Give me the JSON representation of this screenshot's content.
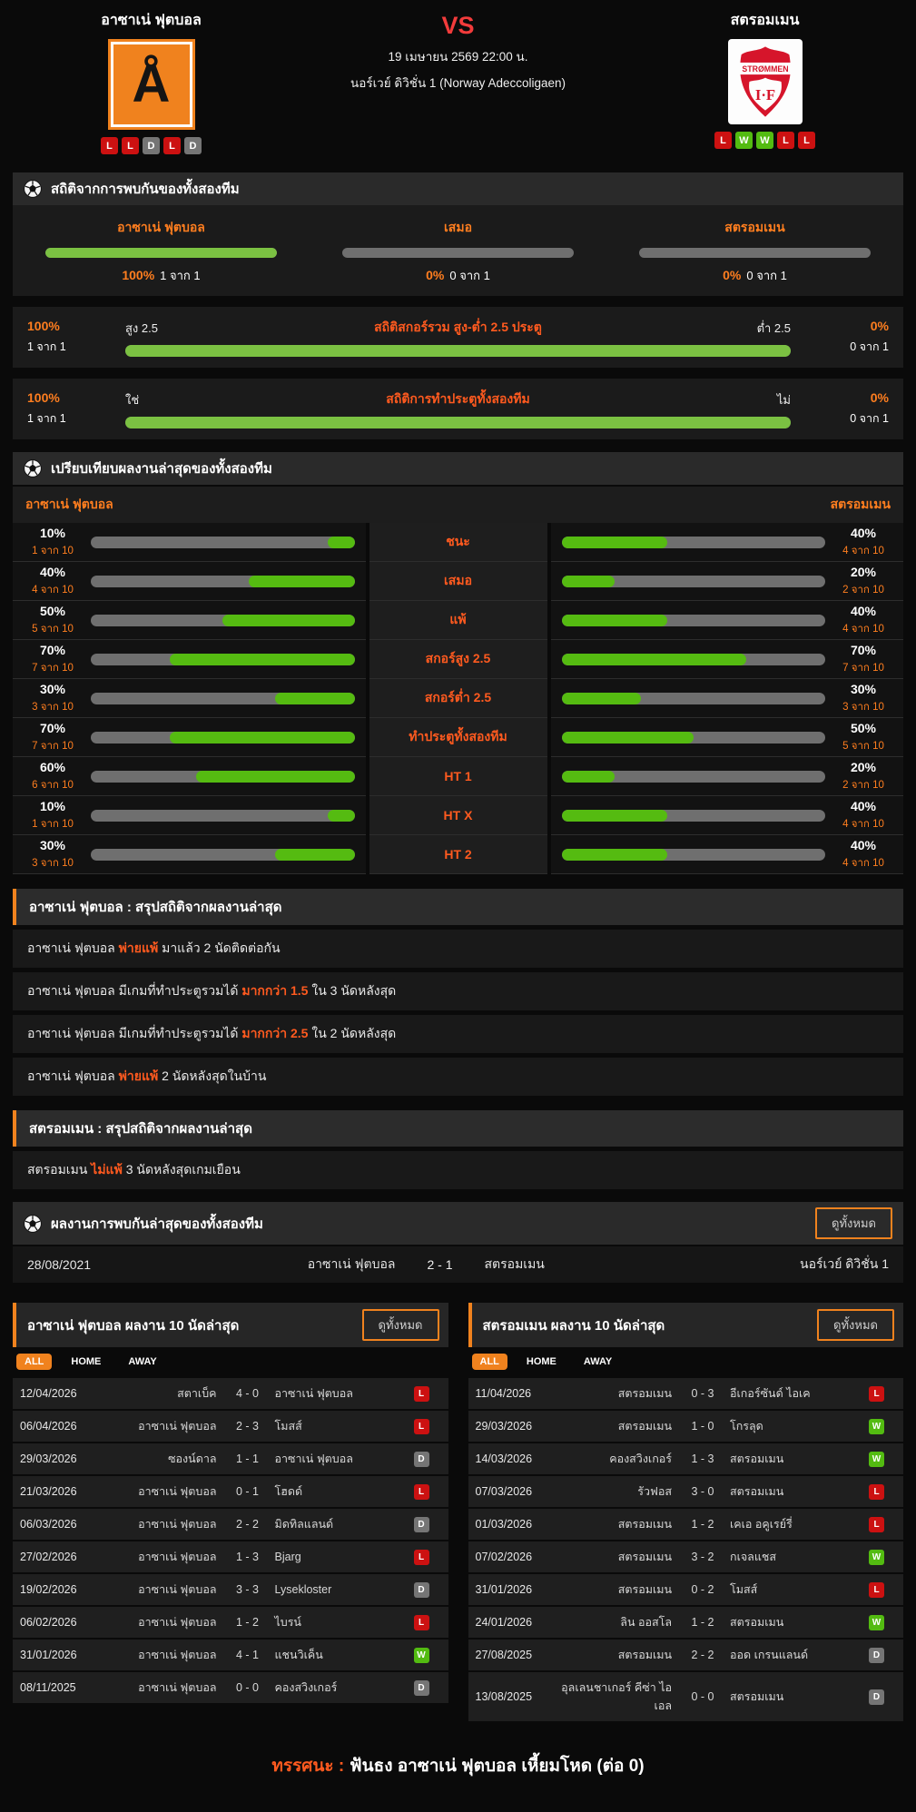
{
  "colors": {
    "accent": "#f0821e",
    "orange_text": "#ff7e1f",
    "green": "#55bb11",
    "green_light": "#7bc142",
    "red_badge": "#cc1111",
    "gray_badge": "#757575",
    "vs_red": "#f23b3b"
  },
  "header": {
    "home": {
      "name": "อาซาเน่ ฟุตบอล",
      "logo_letter": "Å",
      "form": [
        "L",
        "L",
        "D",
        "L",
        "D"
      ]
    },
    "away": {
      "name": "สตรอมเมน",
      "logo_line1": "STRØMMEN",
      "logo_line2": "I·F",
      "form": [
        "L",
        "W",
        "W",
        "L",
        "L"
      ]
    },
    "vs": "VS",
    "datetime": "19 เมษายน 2569 22:00 น.",
    "league": "นอร์เวย์ ดิวิชั่น 1 (Norway Adeccoligaen)"
  },
  "h2h_stats": {
    "title": "สถิติจากการพบกันของทั้งสองทีม",
    "columns": [
      {
        "label": "อาซาเน่ ฟุตบอล",
        "percent": "100%",
        "ratio": "1 จาก 1",
        "fill": 100
      },
      {
        "label": "เสมอ",
        "percent": "0%",
        "ratio": "0 จาก 1",
        "fill": 0
      },
      {
        "label": "สตรอมเมน",
        "percent": "0%",
        "ratio": "0 จาก 1",
        "fill": 0
      }
    ],
    "rows": [
      {
        "title": "สถิติสกอร์รวม สูง-ต่ำ 2.5 ประตู",
        "left_label": "สูง 2.5",
        "right_label": "ต่ำ 2.5",
        "left_percent": "100%",
        "left_ratio": "1 จาก 1",
        "right_percent": "0%",
        "right_ratio": "0 จาก 1",
        "fill": 100
      },
      {
        "title": "สถิติการทำประตูทั้งสองทีม",
        "left_label": "ใช่",
        "right_label": "ไม่",
        "left_percent": "100%",
        "left_ratio": "1 จาก 1",
        "right_percent": "0%",
        "right_ratio": "0 จาก 1",
        "fill": 100
      }
    ]
  },
  "comparison": {
    "title": "เปรียบเทียบผลงานล่าสุดของทั้งสองทีม",
    "home_name": "อาซาเน่ ฟุตบอล",
    "away_name": "สตรอมเมน",
    "rows": [
      {
        "label": "ชนะ",
        "home": {
          "percent": "10%",
          "ratio": "1 จาก 10",
          "value": 10
        },
        "away": {
          "percent": "40%",
          "ratio": "4 จาก 10",
          "value": 40
        }
      },
      {
        "label": "เสมอ",
        "home": {
          "percent": "40%",
          "ratio": "4 จาก 10",
          "value": 40
        },
        "away": {
          "percent": "20%",
          "ratio": "2 จาก 10",
          "value": 20
        }
      },
      {
        "label": "แพ้",
        "home": {
          "percent": "50%",
          "ratio": "5 จาก 10",
          "value": 50
        },
        "away": {
          "percent": "40%",
          "ratio": "4 จาก 10",
          "value": 40
        }
      },
      {
        "label": "สกอร์สูง 2.5",
        "home": {
          "percent": "70%",
          "ratio": "7 จาก 10",
          "value": 70
        },
        "away": {
          "percent": "70%",
          "ratio": "7 จาก 10",
          "value": 70
        }
      },
      {
        "label": "สกอร์ต่ำ 2.5",
        "home": {
          "percent": "30%",
          "ratio": "3 จาก 10",
          "value": 30
        },
        "away": {
          "percent": "30%",
          "ratio": "3 จาก 10",
          "value": 30
        }
      },
      {
        "label": "ทำประตูทั้งสองทีม",
        "home": {
          "percent": "70%",
          "ratio": "7 จาก 10",
          "value": 70
        },
        "away": {
          "percent": "50%",
          "ratio": "5 จาก 10",
          "value": 50
        }
      },
      {
        "label": "HT 1",
        "home": {
          "percent": "60%",
          "ratio": "6 จาก 10",
          "value": 60
        },
        "away": {
          "percent": "20%",
          "ratio": "2 จาก 10",
          "value": 20
        }
      },
      {
        "label": "HT X",
        "home": {
          "percent": "10%",
          "ratio": "1 จาก 10",
          "value": 10
        },
        "away": {
          "percent": "40%",
          "ratio": "4 จาก 10",
          "value": 40
        }
      },
      {
        "label": "HT 2",
        "home": {
          "percent": "30%",
          "ratio": "3 จาก 10",
          "value": 30
        },
        "away": {
          "percent": "40%",
          "ratio": "4 จาก 10",
          "value": 40
        }
      }
    ]
  },
  "home_summary": {
    "title": "อาซาเน่ ฟุตบอล : สรุปสถิติจากผลงานล่าสุด",
    "lines": [
      {
        "pre": "อาซาเน่ ฟุตบอล ",
        "highlight": "พ่ายแพ้",
        "post": " มาแล้ว 2 นัดติดต่อกัน"
      },
      {
        "pre": "อาซาเน่ ฟุตบอล มีเกมที่ทำประตูรวมได้ ",
        "highlight": "มากกว่า 1.5",
        "post": " ใน 3 นัดหลังสุด"
      },
      {
        "pre": "อาซาเน่ ฟุตบอล มีเกมที่ทำประตูรวมได้ ",
        "highlight": "มากกว่า 2.5",
        "post": " ใน 2 นัดหลังสุด"
      },
      {
        "pre": "อาซาเน่ ฟุตบอล ",
        "highlight": "พ่ายแพ้",
        "post": " 2 นัดหลังสุดในบ้าน"
      }
    ]
  },
  "away_summary": {
    "title": "สตรอมเมน : สรุปสถิติจากผลงานล่าสุด",
    "lines": [
      {
        "pre": "สตรอมเมน ",
        "highlight": "ไม่แพ้",
        "post": " 3 นัดหลังสุดเกมเยือน"
      }
    ]
  },
  "h2h_recent": {
    "title": "ผลงานการพบกันล่าสุดของทั้งสองทีม",
    "view_all_label": "ดูทั้งหมด",
    "matches": [
      {
        "date": "28/08/2021",
        "home": "อาซาเน่ ฟุตบอล",
        "score": "2 - 1",
        "away": "สตรอมเมน",
        "league": "นอร์เวย์ ดิวิชั่น 1"
      }
    ]
  },
  "recent_tables": [
    {
      "title": "อาซาเน่ ฟุตบอล ผลงาน 10 นัดล่าสุด",
      "view_all_label": "ดูทั้งหมด",
      "tabs": [
        "ALL",
        "HOME",
        "AWAY"
      ],
      "active_tab": "ALL",
      "rows": [
        {
          "date": "12/04/2026",
          "home": "สตาเบ็ค",
          "score": "4 - 0",
          "away": "อาซาเน่ ฟุตบอล",
          "result": "L"
        },
        {
          "date": "06/04/2026",
          "home": "อาซาเน่ ฟุตบอล",
          "score": "2 - 3",
          "away": "โมสส์",
          "result": "L"
        },
        {
          "date": "29/03/2026",
          "home": "ซองน์ดาล",
          "score": "1 - 1",
          "away": "อาซาเน่ ฟุตบอล",
          "result": "D"
        },
        {
          "date": "21/03/2026",
          "home": "อาซาเน่ ฟุตบอล",
          "score": "0 - 1",
          "away": "โฮดด์",
          "result": "L"
        },
        {
          "date": "06/03/2026",
          "home": "อาซาเน่ ฟุตบอล",
          "score": "2 - 2",
          "away": "มิดทิลแลนด์",
          "result": "D"
        },
        {
          "date": "27/02/2026",
          "home": "อาซาเน่ ฟุตบอล",
          "score": "1 - 3",
          "away": "Bjarg",
          "result": "L"
        },
        {
          "date": "19/02/2026",
          "home": "อาซาเน่ ฟุตบอล",
          "score": "3 - 3",
          "away": "Lysekloster",
          "result": "D"
        },
        {
          "date": "06/02/2026",
          "home": "อาซาเน่ ฟุตบอล",
          "score": "1 - 2",
          "away": "ไบรน์",
          "result": "L"
        },
        {
          "date": "31/01/2026",
          "home": "อาซาเน่ ฟุตบอล",
          "score": "4 - 1",
          "away": "แชนวิเค็น",
          "result": "W"
        },
        {
          "date": "08/11/2025",
          "home": "อาซาเน่ ฟุตบอล",
          "score": "0 - 0",
          "away": "คองสวิงเกอร์",
          "result": "D"
        }
      ]
    },
    {
      "title": "สตรอมเมน ผลงาน 10 นัดล่าสุด",
      "view_all_label": "ดูทั้งหมด",
      "tabs": [
        "ALL",
        "HOME",
        "AWAY"
      ],
      "active_tab": "ALL",
      "rows": [
        {
          "date": "11/04/2026",
          "home": "สตรอมเมน",
          "score": "0 - 3",
          "away": "อีเกอร์ซันด์ ไอเค",
          "result": "L"
        },
        {
          "date": "29/03/2026",
          "home": "สตรอมเมน",
          "score": "1 - 0",
          "away": "โกรลุด",
          "result": "W"
        },
        {
          "date": "14/03/2026",
          "home": "คองสวิงเกอร์",
          "score": "1 - 3",
          "away": "สตรอมเมน",
          "result": "W"
        },
        {
          "date": "07/03/2026",
          "home": "รัวฟอส",
          "score": "3 - 0",
          "away": "สตรอมเมน",
          "result": "L"
        },
        {
          "date": "01/03/2026",
          "home": "สตรอมเมน",
          "score": "1 - 2",
          "away": "เคเอ อคูเรย์รี่",
          "result": "L"
        },
        {
          "date": "07/02/2026",
          "home": "สตรอมเมน",
          "score": "3 - 2",
          "away": "กเจลแชส",
          "result": "W"
        },
        {
          "date": "31/01/2026",
          "home": "สตรอมเมน",
          "score": "0 - 2",
          "away": "โมสส์",
          "result": "L"
        },
        {
          "date": "24/01/2026",
          "home": "ลิน ออสโล",
          "score": "1 - 2",
          "away": "สตรอมเมน",
          "result": "W"
        },
        {
          "date": "27/08/2025",
          "home": "สตรอมเมน",
          "score": "2 - 2",
          "away": "ออด เกรนแลนด์",
          "result": "D"
        },
        {
          "date": "13/08/2025",
          "home": "อุลเลนชาเกอร์ คีซ่า ไอเอล",
          "score": "0 - 0",
          "away": "สตรอมเมน",
          "result": "D"
        }
      ]
    }
  ],
  "footer": {
    "label": "ทรรศนะ :",
    "text": "ฟันธง อาซาเน่ ฟุตบอล เหี้ยมโหด (ต่อ 0)"
  }
}
